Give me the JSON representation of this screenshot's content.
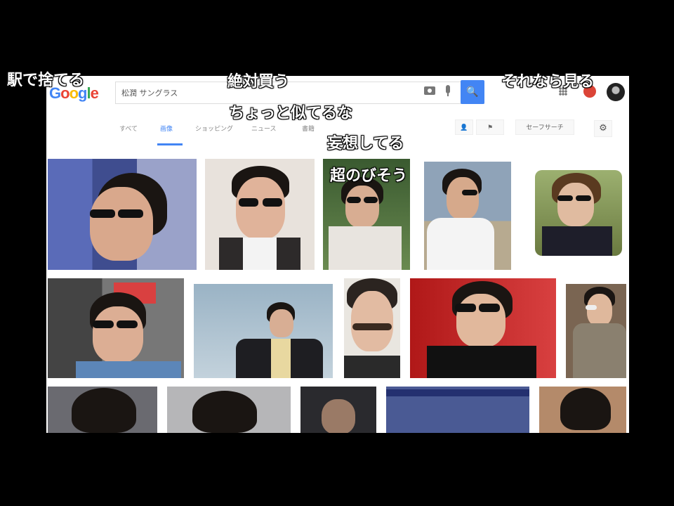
{
  "browser": {
    "logo": "Google",
    "search_query": "松潤 サングラス",
    "search_button": "🔍"
  },
  "tabs": [
    {
      "label": "すべて",
      "active": false
    },
    {
      "label": "画像",
      "active": true
    },
    {
      "label": "ショッピング",
      "active": false
    },
    {
      "label": "ニュース",
      "active": false
    },
    {
      "label": "書籍",
      "active": false
    }
  ],
  "tools": {
    "safesearch_label": "セーフサーチ",
    "gear_icon": "gear-icon"
  },
  "comments": [
    {
      "text": "駅で捨てる"
    },
    {
      "text": "絶対買う"
    },
    {
      "text": "それなら見る"
    },
    {
      "text": "ちょっと似てるな"
    },
    {
      "text": "妄想してる"
    },
    {
      "text": "超のびそう"
    }
  ],
  "colors": {
    "accent": "#4285f4",
    "background": "#000000",
    "notification": "#db4437"
  }
}
